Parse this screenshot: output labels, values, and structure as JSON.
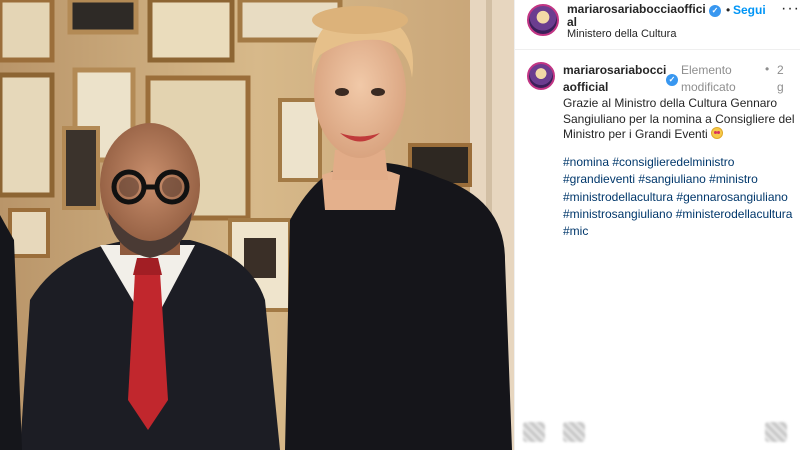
{
  "post": {
    "username": "mariarosariabocciaofficial",
    "follow_label": "Segui",
    "location": "Ministero della Cultura",
    "separator": "•",
    "more": "···"
  },
  "comment": {
    "username": "mariarosariabocciaofficial",
    "edited_label": "Elemento modificato",
    "time": "2g",
    "dot": "•",
    "caption": "Grazie al Ministro della Cultura Gennaro Sangiuliano per la nomina a Consigliere del Ministro per i Grandi Eventi",
    "hashtags": [
      "#nomina",
      "#consiglieredelministro",
      "#grandieventi",
      "#sangiuliano",
      "#ministro",
      "#ministrodellacultura",
      "#gennarosangiuliano",
      "#ministrosangiuliano",
      "#ministerodellacultura",
      "#mic"
    ]
  },
  "icons": {
    "verified": "verified-badge-icon",
    "emoji": "heart-eyes-emoji-icon",
    "footer": [
      "like-icon",
      "comment-icon",
      "save-icon"
    ]
  },
  "colors": {
    "link": "#00376b",
    "follow": "#0095f6",
    "verified": "#3897f0",
    "muted": "#8e8e8e"
  }
}
